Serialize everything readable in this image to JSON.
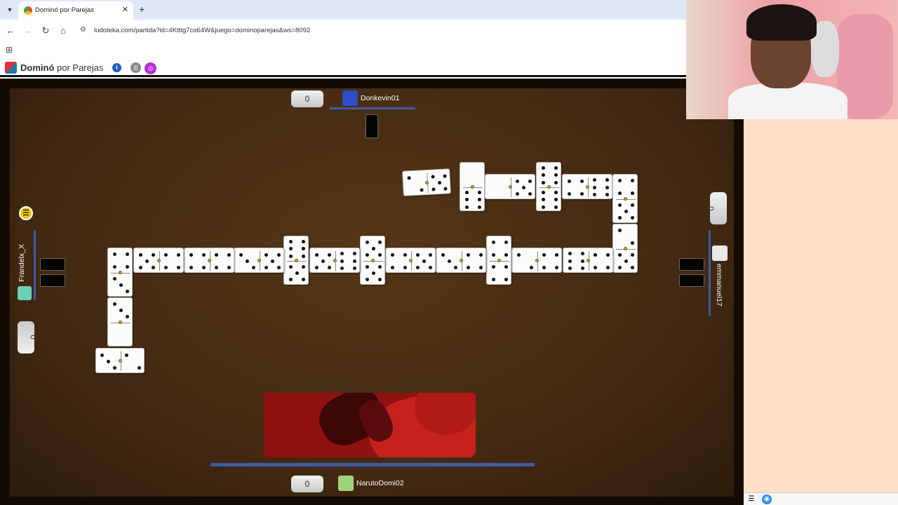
{
  "browser": {
    "tab_title": "Dominó por Parejas",
    "url": "ludoteka.com/partida?id=4Ktttg7co64W&juego=dominoparejas&ws=8092"
  },
  "site": {
    "title_bold": "Dominó",
    "title_rest": " por Parejas"
  },
  "game": {
    "players": {
      "top": {
        "name": "Donkevin01",
        "score": "0"
      },
      "left": {
        "name": "Frandelx_X",
        "score": "0"
      },
      "right": {
        "name": "emmanuel17",
        "score": "0"
      },
      "bottom": {
        "name": "NarutoDomi02",
        "score": "0"
      }
    },
    "tiles_on_board": [
      [
        2,
        5
      ],
      [
        0,
        6
      ],
      [
        0,
        5
      ],
      [
        6,
        6
      ],
      [
        4,
        6
      ],
      [
        4,
        5
      ],
      [
        2,
        5
      ],
      [
        6,
        4
      ],
      [
        2,
        4
      ],
      [
        4,
        4
      ],
      [
        3,
        4
      ],
      [
        4,
        5
      ],
      [
        5,
        5
      ],
      [
        5,
        6
      ],
      [
        6,
        5
      ],
      [
        3,
        5
      ],
      [
        4,
        4
      ],
      [
        5,
        4
      ],
      [
        4,
        3
      ],
      [
        3,
        0
      ],
      [
        3,
        2
      ],
      [
        1,
        3
      ],
      [
        3,
        3
      ]
    ]
  },
  "colors": {
    "board": "#442a12",
    "frame": "#130c05",
    "player_line": "#3d5aa5",
    "turn_indicator": "#f1c40f",
    "side_panel": "#fde0c6"
  }
}
